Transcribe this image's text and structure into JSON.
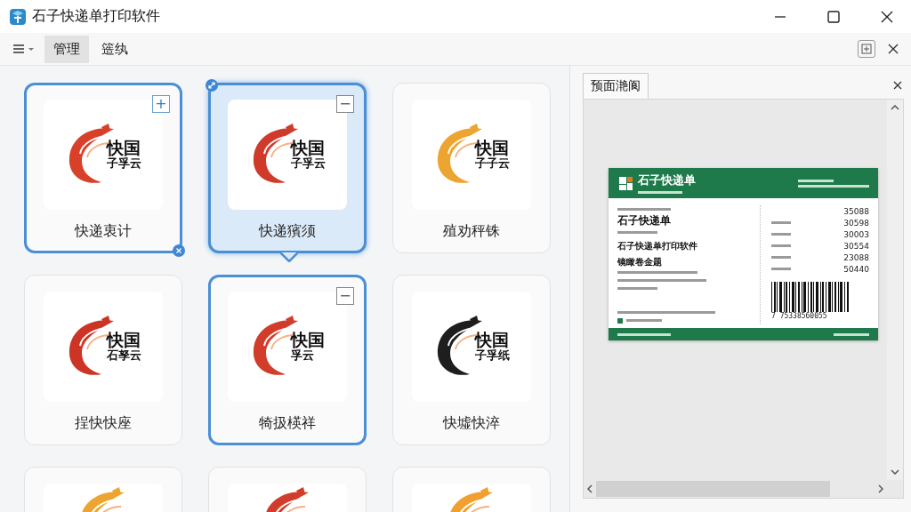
{
  "window": {
    "title": "石子快递单打印软件"
  },
  "toolbar": {
    "tabs": [
      {
        "label": "管理",
        "selected": true
      },
      {
        "label": "簉纨",
        "selected": false
      }
    ]
  },
  "cards": [
    {
      "label": "快递衷计",
      "logo_text": [
        "快国",
        "子孚云"
      ],
      "color": "#d8402a",
      "selected": false,
      "outlined": true,
      "action": "+",
      "badge": {
        "kind": "close"
      }
    },
    {
      "label": "快递獱须",
      "logo_text": [
        "快国",
        "子孚云"
      ],
      "color": "#cf3a2a",
      "selected": true,
      "outlined": true,
      "action": "−",
      "badge": {
        "kind": "resize"
      }
    },
    {
      "label": "殖劝秤铢",
      "logo_text": [
        "快国",
        "子子云"
      ],
      "color": "#eda531",
      "selected": false,
      "outlined": false
    },
    {
      "label": "挰快快座",
      "logo_text": [
        "快国",
        "石孥云"
      ],
      "color": "#cc3526",
      "selected": false,
      "outlined": false
    },
    {
      "label": "犄扱楧祥",
      "logo_text": [
        "快国",
        "孚云"
      ],
      "color": "#d23c2a",
      "selected": false,
      "outlined": true,
      "action": "−"
    },
    {
      "label": "快墟快淬",
      "logo_text": [
        "快国",
        "子孚纸"
      ],
      "color": "#1e1e1e",
      "selected": false,
      "outlined": false
    },
    {
      "color": "#eda531",
      "selected": false,
      "outlined": false
    },
    {
      "color": "#d23c2a",
      "selected": false,
      "outlined": false
    },
    {
      "color": "#f0a030",
      "selected": false,
      "outlined": false
    }
  ],
  "preview": {
    "tab": "预面滟阆",
    "label": {
      "brand": "石子快递单",
      "title": "石子快递单",
      "subtitle": "石子快递单打印软件",
      "heading": "镜瞰卷金题",
      "values": [
        "35088",
        "30598",
        "30003",
        "30554",
        "23088",
        "50440"
      ],
      "barcode_number": "7 75338560055"
    }
  }
}
